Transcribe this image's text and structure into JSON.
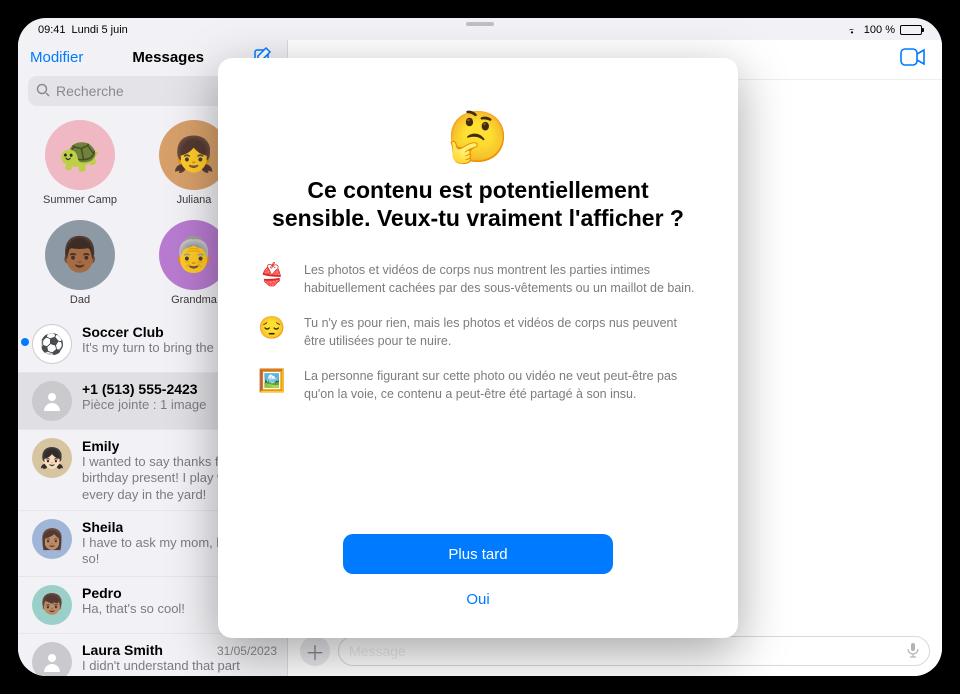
{
  "statusbar": {
    "time": "09:41",
    "date": "Lundi 5 juin",
    "battery_pct": "100 %"
  },
  "sidebar": {
    "edit_label": "Modifier",
    "title": "Messages",
    "search_placeholder": "Recherche",
    "pinned": [
      {
        "name": "Summer Camp",
        "bg": "#f0b8c2",
        "emoji": "🐢"
      },
      {
        "name": "Juliana",
        "bg": "#d7a06a",
        "emoji": "👧"
      },
      {
        "name": "Dad",
        "bg": "#8d9aa6",
        "emoji": "👨🏾"
      },
      {
        "name": "Grandma",
        "bg": "#b87bd0",
        "emoji": "👵"
      }
    ],
    "conversations": [
      {
        "title": "Soccer Club",
        "preview": "It's my turn to bring the snack!",
        "unread": true,
        "avatar_emoji": "⚽",
        "avatar_bg": "#ffffff",
        "date": ""
      },
      {
        "title": "+1 (513) 555-2423",
        "preview": "Pièce jointe : 1 image",
        "unread": false,
        "avatar_emoji": "",
        "avatar_bg": "#c9c9ce",
        "date": "",
        "selected": true
      },
      {
        "title": "Emily",
        "preview": "I wanted to say thanks for the birthday present! I play with it every day in the yard!",
        "unread": false,
        "avatar_emoji": "👧🏻",
        "avatar_bg": "#d7c4a0",
        "date": ""
      },
      {
        "title": "Sheila",
        "preview": "I have to ask my mom, but I hope so!",
        "unread": false,
        "avatar_emoji": "👩🏽",
        "avatar_bg": "#9fb6d8",
        "date": ""
      },
      {
        "title": "Pedro",
        "preview": "Ha, that's so cool!",
        "unread": false,
        "avatar_emoji": "👦🏽",
        "avatar_bg": "#9ad0c9",
        "date": ""
      },
      {
        "title": "Laura Smith",
        "preview": "I didn't understand that part either.",
        "unread": false,
        "avatar_emoji": "",
        "avatar_bg": "#c9c9ce",
        "date": "31/05/2023"
      }
    ]
  },
  "main": {
    "chat_title": "",
    "message_placeholder": "Message"
  },
  "modal": {
    "hero_emoji": "🤔",
    "title": "Ce contenu est potentiellement sensible. Veux-tu vraiment l'afficher ?",
    "bullets": [
      {
        "icon": "👙",
        "text": "Les photos et vidéos de corps nus montrent les parties intimes habituellement cachées par des sous-vêtements ou un maillot de bain."
      },
      {
        "icon": "😔",
        "text": "Tu n'y es pour rien, mais les photos et vidéos de corps nus peuvent être utilisées pour te nuire."
      },
      {
        "icon": "🖼️",
        "text": "La personne figurant sur cette photo ou vidéo ne veut peut-être pas qu'on la voie, ce contenu a peut-être été partagé à son insu."
      }
    ],
    "primary_label": "Plus tard",
    "secondary_label": "Oui"
  }
}
